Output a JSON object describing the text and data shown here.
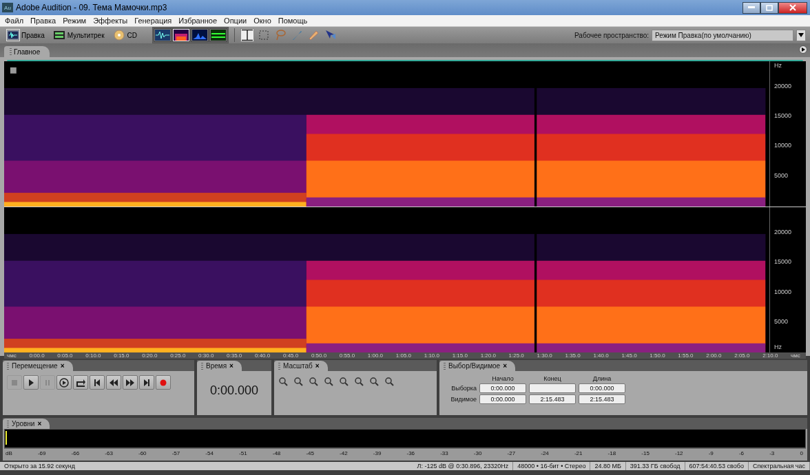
{
  "window": {
    "app_icon": "Au",
    "title": "Adobe Audition - 09. Тема Мамочки.mp3"
  },
  "menu": [
    "Файл",
    "Правка",
    "Режим",
    "Эффекты",
    "Генерация",
    "Избранное",
    "Опции",
    "Окно",
    "Помощь"
  ],
  "toolbar": {
    "modes": [
      {
        "label": "Правка",
        "kind": "edit",
        "selected": true
      },
      {
        "label": "Мультитрек",
        "kind": "multitrack",
        "selected": false
      },
      {
        "label": "CD",
        "kind": "cd",
        "selected": false
      }
    ],
    "views": [
      {
        "kind": "waveform",
        "selected": false
      },
      {
        "kind": "spectral",
        "selected": true
      },
      {
        "kind": "pan",
        "selected": false
      },
      {
        "kind": "phase",
        "selected": false
      }
    ],
    "tools": [
      {
        "kind": "time-select",
        "selected": true
      },
      {
        "kind": "marquee",
        "selected": false
      },
      {
        "kind": "lasso",
        "selected": false
      },
      {
        "kind": "brush",
        "selected": false
      },
      {
        "kind": "heal",
        "selected": false
      },
      {
        "kind": "scrub",
        "selected": false
      }
    ],
    "workspace_label": "Рабочее пространство:",
    "workspace_value": "Режим Правка(по умолчанию)"
  },
  "main_tab": "Главное",
  "channels": [
    {
      "axis": [
        {
          "kind": "unit",
          "label": "Hz"
        },
        {
          "kind": "tick",
          "label": "20000"
        },
        {
          "kind": "tick",
          "label": "15000"
        },
        {
          "kind": "tick",
          "label": "10000"
        },
        {
          "kind": "tick",
          "label": "5000"
        }
      ]
    },
    {
      "axis": [
        {
          "kind": "tick",
          "label": "20000"
        },
        {
          "kind": "tick",
          "label": "15000"
        },
        {
          "kind": "tick",
          "label": "10000"
        },
        {
          "kind": "tick",
          "label": "5000"
        },
        {
          "kind": "unit",
          "label": "Hz"
        }
      ]
    }
  ],
  "timeline": [
    "чмс",
    "0:00.0",
    "0:05.0",
    "0:10.0",
    "0:15.0",
    "0:20.0",
    "0:25.0",
    "0:30.0",
    "0:35.0",
    "0:40.0",
    "0:45.0",
    "0:50.0",
    "0:55.0",
    "1:00.0",
    "1:05.0",
    "1:10.0",
    "1:15.0",
    "1:20.0",
    "1:25.0",
    "1:30.0",
    "1:35.0",
    "1:40.0",
    "1:45.0",
    "1:50.0",
    "1:55.0",
    "2:00.0",
    "2:05.0",
    "2:10.0",
    "чмс"
  ],
  "transport": {
    "title": "Перемещение",
    "close": "×",
    "buttons": [
      {
        "kind": "stop",
        "disabled": true
      },
      {
        "kind": "play",
        "disabled": false
      },
      {
        "kind": "pause",
        "disabled": true
      },
      {
        "kind": "play-cursor",
        "disabled": false
      },
      {
        "kind": "loop",
        "disabled": false
      },
      {
        "kind": "start",
        "disabled": false
      },
      {
        "kind": "rewind",
        "disabled": false
      },
      {
        "kind": "forward",
        "disabled": false
      },
      {
        "kind": "end",
        "disabled": false
      },
      {
        "kind": "record",
        "disabled": false
      }
    ]
  },
  "time": {
    "title": "Время",
    "close": "×",
    "value": "0:00.000"
  },
  "zoom": {
    "title": "Масштаб",
    "close": "×"
  },
  "selection": {
    "title": "Выбор/Видимое",
    "close": "×",
    "columns": [
      "Начало",
      "Конец",
      "Длина"
    ],
    "rows": [
      {
        "label": "Выборка",
        "cells": [
          {
            "text": "0:00.000"
          },
          {},
          {
            "text": "0:00.000"
          }
        ]
      },
      {
        "label": "Видимое",
        "cells": [
          {
            "text": "0:00.000"
          },
          {
            "text": "2:15.483"
          },
          {
            "text": "2:15.483"
          }
        ]
      }
    ]
  },
  "levels": {
    "title": "Уровни",
    "close": "×",
    "scale": [
      "dB",
      "-69",
      "-66",
      "-63",
      "-60",
      "-57",
      "-54",
      "-51",
      "-48",
      "-45",
      "-42",
      "-39",
      "-36",
      "-33",
      "-30",
      "-27",
      "-24",
      "-21",
      "-18",
      "-15",
      "-12",
      "-9",
      "-6",
      "-3",
      "0"
    ]
  },
  "status": [
    "Открыто за 15.92 секунд",
    "Л: -125 dB @  0:30.896, 23320Hz",
    "48000 • 16-бит • Стерео",
    "24.80 МБ",
    "391.33 ГБ свобод",
    "607:54:40.53 свобо",
    "Спектральная час"
  ]
}
